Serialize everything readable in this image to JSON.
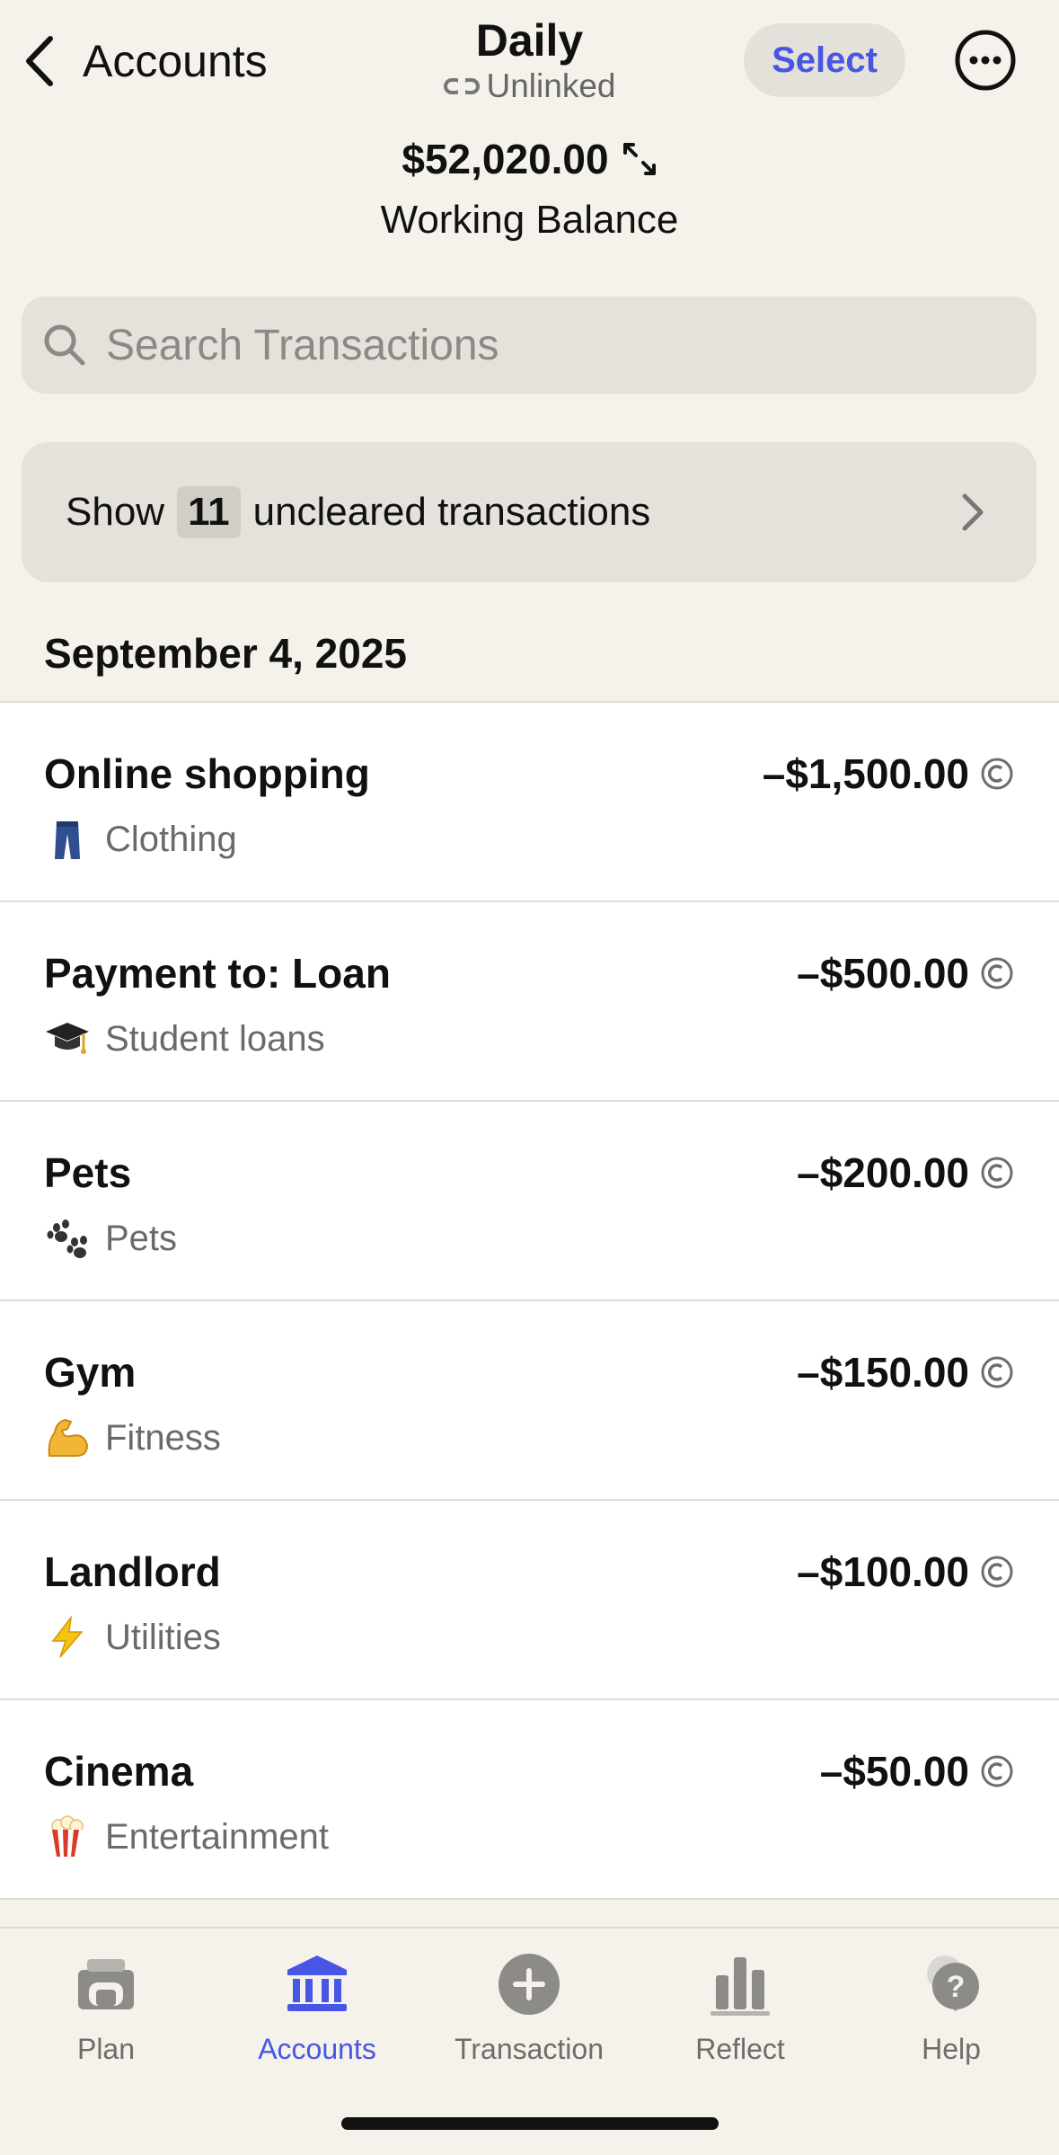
{
  "header": {
    "back_label": "Accounts",
    "title": "Daily",
    "subtitle": "Unlinked",
    "select_label": "Select",
    "balance_amount": "$52,020.00",
    "balance_label": "Working Balance"
  },
  "search": {
    "placeholder": "Search Transactions"
  },
  "uncleared": {
    "prefix": "Show",
    "count": "11",
    "suffix": "uncleared transactions"
  },
  "list": {
    "date": "September 4, 2025",
    "transactions": [
      {
        "name": "Online shopping",
        "amount": "–$1,500.00",
        "category": "Clothing",
        "icon": "jeans-icon"
      },
      {
        "name": "Payment to: Loan",
        "amount": "–$500.00",
        "category": "Student loans",
        "icon": "graduation-cap-icon"
      },
      {
        "name": "Pets",
        "amount": "–$200.00",
        "category": "Pets",
        "icon": "paw-prints-icon"
      },
      {
        "name": "Gym",
        "amount": "–$150.00",
        "category": "Fitness",
        "icon": "flexed-biceps-icon"
      },
      {
        "name": "Landlord",
        "amount": "–$100.00",
        "category": "Utilities",
        "icon": "lightning-icon"
      },
      {
        "name": "Cinema",
        "amount": "–$50.00",
        "category": "Entertainment",
        "icon": "popcorn-icon"
      }
    ]
  },
  "tabbar": {
    "tabs": [
      {
        "label": "Plan",
        "icon": "plan-icon"
      },
      {
        "label": "Accounts",
        "icon": "bank-icon",
        "active": true
      },
      {
        "label": "Transaction",
        "icon": "add-circle-icon"
      },
      {
        "label": "Reflect",
        "icon": "bar-chart-icon"
      },
      {
        "label": "Help",
        "icon": "help-bubble-icon"
      }
    ]
  },
  "colors": {
    "accent": "#4856e5",
    "background": "#f4f2ea",
    "field": "#e4e2da"
  }
}
